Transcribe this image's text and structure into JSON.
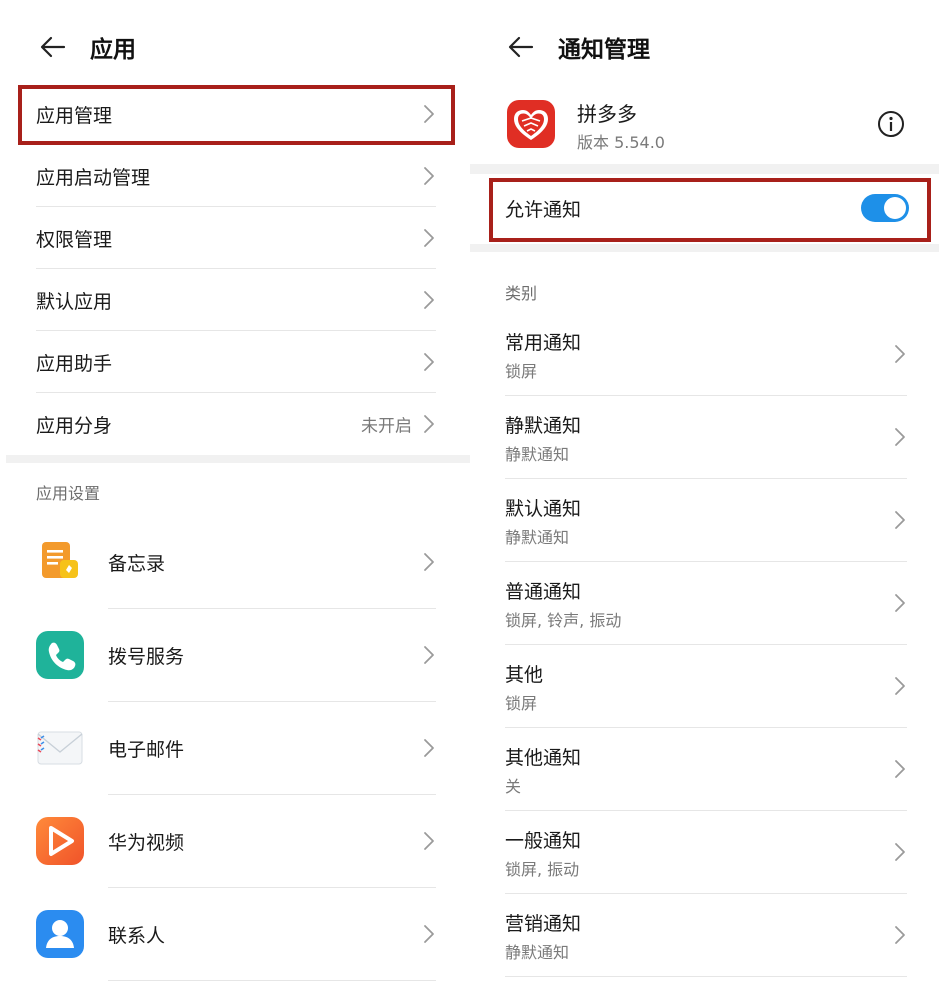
{
  "left": {
    "header": {
      "back_icon": "arrow-left-icon",
      "title": "应用"
    },
    "menu_items": [
      {
        "label": "应用管理",
        "value": ""
      },
      {
        "label": "应用启动管理",
        "value": ""
      },
      {
        "label": "权限管理",
        "value": ""
      },
      {
        "label": "默认应用",
        "value": ""
      },
      {
        "label": "应用助手",
        "value": ""
      },
      {
        "label": "应用分身",
        "value": "未开启"
      }
    ],
    "section_label": "应用设置",
    "apps": [
      {
        "label": "备忘录",
        "icon": "notepad-icon"
      },
      {
        "label": "拨号服务",
        "icon": "phone-icon"
      },
      {
        "label": "电子邮件",
        "icon": "mail-envelope-icon"
      },
      {
        "label": "华为视频",
        "icon": "video-play-icon"
      },
      {
        "label": "联系人",
        "icon": "contact-person-icon"
      }
    ],
    "colors": {
      "highlight": "#a8201a"
    }
  },
  "right": {
    "header": {
      "back_icon": "arrow-left-icon",
      "title": "通知管理"
    },
    "app": {
      "name": "拼多多",
      "version": "版本 5.54.0",
      "icon": "pinduoduo-heart-icon",
      "info_icon": "info-circle-icon"
    },
    "allow": {
      "label": "允许通知",
      "enabled": true
    },
    "category_label": "类别",
    "categories": [
      {
        "title": "常用通知",
        "sub": "锁屏"
      },
      {
        "title": "静默通知",
        "sub": "静默通知"
      },
      {
        "title": "默认通知",
        "sub": "静默通知"
      },
      {
        "title": "普通通知",
        "sub": "锁屏, 铃声, 振动"
      },
      {
        "title": "其他",
        "sub": "锁屏"
      },
      {
        "title": "其他通知",
        "sub": "关"
      },
      {
        "title": "一般通知",
        "sub": "锁屏, 振动"
      },
      {
        "title": "营销通知",
        "sub": "静默通知"
      }
    ],
    "colors": {
      "toggle_on": "#1e90e8",
      "pdd_red": "#e02e24"
    }
  }
}
